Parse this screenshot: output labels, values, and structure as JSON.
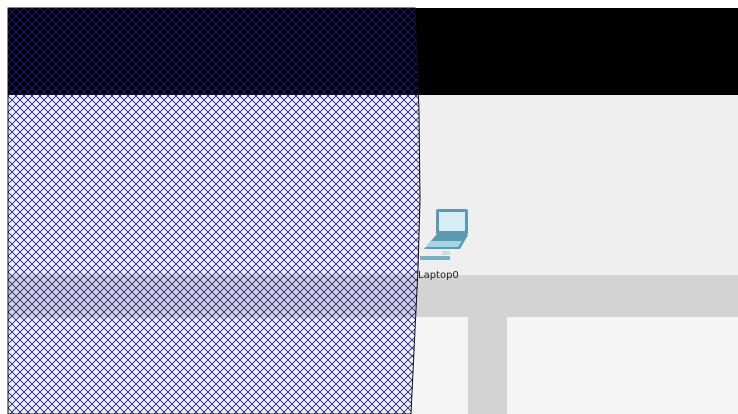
{
  "canvas": {
    "devices": [
      {
        "label": "Laptop0",
        "icon": "laptop-icon"
      }
    ]
  },
  "colors": {
    "hatch": "#1b1b8c",
    "top_band": "#000000",
    "workspace": "#efefef",
    "corridor": "#d3d3d3",
    "laptop_body": "#5a9ab0",
    "laptop_screen": "#d8eef6"
  }
}
